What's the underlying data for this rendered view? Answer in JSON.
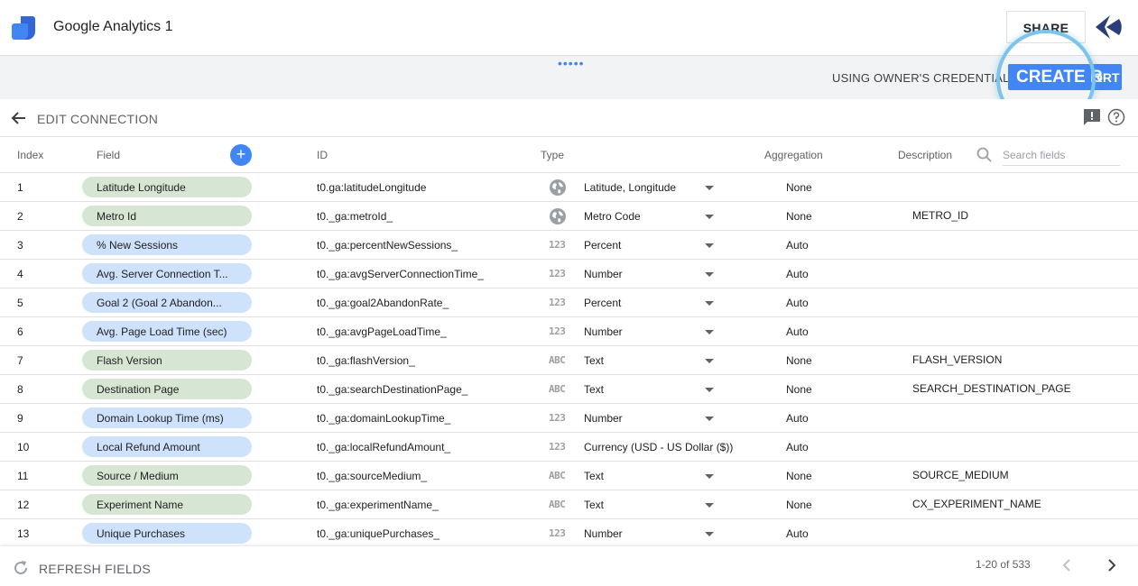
{
  "app": {
    "title": "Google Analytics 1"
  },
  "header": {
    "share_label": "SHARE"
  },
  "subbar": {
    "drag_handle": "•••••",
    "credentials_text": "USING OWNER'S CREDENTIALS",
    "create_label_big": "CREATE R",
    "create_label_small": "ORT"
  },
  "connection": {
    "title": "EDIT CONNECTION"
  },
  "table": {
    "headers": {
      "index": "Index",
      "field": "Field",
      "id": "ID",
      "type": "Type",
      "aggregation": "Aggregation",
      "description": "Description"
    },
    "search_placeholder": "Search fields",
    "rows": [
      {
        "index": "1",
        "field": "Latitude Longitude",
        "kind": "dimension",
        "id": "t0.ga:latitudeLongitude",
        "type_icon": "globe-icon",
        "type": "Latitude, Longitude",
        "aggregation": "None",
        "description": ""
      },
      {
        "index": "2",
        "field": "Metro Id",
        "kind": "dimension",
        "id": "t0._ga:metroId_",
        "type_icon": "globe-icon",
        "type": "Metro Code",
        "aggregation": "None",
        "description": "METRO_ID"
      },
      {
        "index": "3",
        "field": "% New Sessions",
        "kind": "metric",
        "id": "t0._ga:percentNewSessions_",
        "type_icon": "number-icon",
        "type": "Percent",
        "aggregation": "Auto",
        "description": ""
      },
      {
        "index": "4",
        "field": "Avg. Server Connection T...",
        "kind": "metric",
        "id": "t0._ga:avgServerConnectionTime_",
        "type_icon": "number-icon",
        "type": "Number",
        "aggregation": "Auto",
        "description": ""
      },
      {
        "index": "5",
        "field": "Goal 2 (Goal 2 Abandon...",
        "kind": "metric",
        "id": "t0._ga:goal2AbandonRate_",
        "type_icon": "number-icon",
        "type": "Percent",
        "aggregation": "Auto",
        "description": ""
      },
      {
        "index": "6",
        "field": "Avg. Page Load Time (sec)",
        "kind": "metric",
        "id": "t0._ga:avgPageLoadTime_",
        "type_icon": "number-icon",
        "type": "Number",
        "aggregation": "Auto",
        "description": ""
      },
      {
        "index": "7",
        "field": "Flash Version",
        "kind": "dimension",
        "id": "t0._ga:flashVersion_",
        "type_icon": "text-icon",
        "type": "Text",
        "aggregation": "None",
        "description": "FLASH_VERSION"
      },
      {
        "index": "8",
        "field": "Destination Page",
        "kind": "dimension",
        "id": "t0._ga:searchDestinationPage_",
        "type_icon": "text-icon",
        "type": "Text",
        "aggregation": "None",
        "description": "SEARCH_DESTINATION_PAGE"
      },
      {
        "index": "9",
        "field": "Domain Lookup Time (ms)",
        "kind": "metric",
        "id": "t0._ga:domainLookupTime_",
        "type_icon": "number-icon",
        "type": "Number",
        "aggregation": "Auto",
        "description": ""
      },
      {
        "index": "10",
        "field": "Local Refund Amount",
        "kind": "metric",
        "id": "t0._ga:localRefundAmount_",
        "type_icon": "number-icon",
        "type": "Currency (USD - US Dollar ($))",
        "aggregation": "Auto",
        "description": ""
      },
      {
        "index": "11",
        "field": "Source / Medium",
        "kind": "dimension",
        "id": "t0._ga:sourceMedium_",
        "type_icon": "text-icon",
        "type": "Text",
        "aggregation": "None",
        "description": "SOURCE_MEDIUM"
      },
      {
        "index": "12",
        "field": "Experiment Name",
        "kind": "dimension",
        "id": "t0._ga:experimentName_",
        "type_icon": "text-icon",
        "type": "Text",
        "aggregation": "None",
        "description": "CX_EXPERIMENT_NAME"
      },
      {
        "index": "13",
        "field": "Unique Purchases",
        "kind": "metric",
        "id": "t0._ga:uniquePurchases_",
        "type_icon": "number-icon",
        "type": "Number",
        "aggregation": "Auto",
        "description": ""
      }
    ]
  },
  "footer": {
    "refresh_label": "REFRESH FIELDS",
    "pagination": "1-20 of 533"
  },
  "colors": {
    "accent": "#4285f4",
    "dimension_pill": "#d6e6d3",
    "metric_pill": "#cfe2fb",
    "spotlight": "#7cc4ea"
  },
  "icon_text": {
    "number": "123",
    "text": "ABC"
  }
}
